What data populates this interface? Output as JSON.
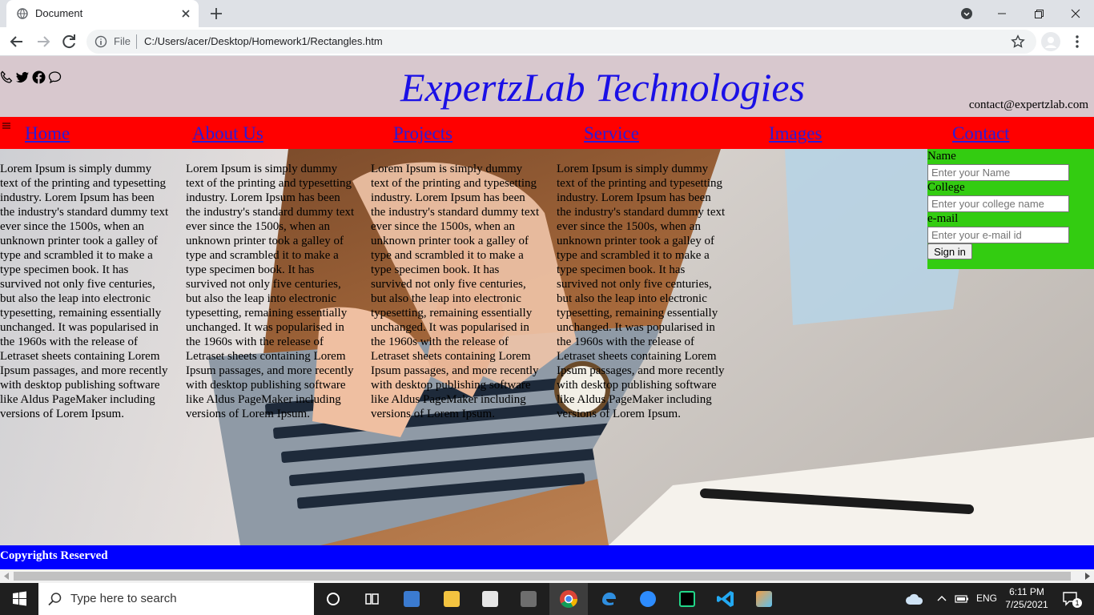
{
  "browser": {
    "tab_title": "Document",
    "omnibox_scheme": "File",
    "url": "C:/Users/acer/Desktop/Homework1/Rectangles.htm"
  },
  "page": {
    "header": {
      "title": "ExpertzLab Technologies",
      "email": "contact@expertzlab.com",
      "social_icons": [
        "phone-icon",
        "twitter-icon",
        "facebook-icon",
        "chat-icon"
      ]
    },
    "nav": {
      "items": [
        "Home",
        "About Us",
        "Projects",
        "Service",
        "Images",
        "Contact"
      ]
    },
    "columns": [
      "Lorem Ipsum is simply dummy text of the printing and typesetting industry. Lorem Ipsum has been the industry's standard dummy text ever since the 1500s, when an unknown printer took a galley of type and scrambled it to make a type specimen book. It has survived not only five centuries, but also the leap into electronic typesetting, remaining essentially unchanged. It was popularised in the 1960s with the release of Letraset sheets containing Lorem Ipsum passages, and more recently with desktop publishing software like Aldus PageMaker including versions of Lorem Ipsum.",
      "Lorem Ipsum is simply dummy text of the printing and typesetting industry. Lorem Ipsum has been the industry's standard dummy text ever since the 1500s, when an unknown printer took a galley of type and scrambled it to make a type specimen book. It has survived not only five centuries, but also the leap into electronic typesetting, remaining essentially unchanged. It was popularised in the 1960s with the release of Letraset sheets containing Lorem Ipsum passages, and more recently with desktop publishing software like Aldus PageMaker including versions of Lorem Ipsum.",
      "Lorem Ipsum is simply dummy text of the printing and typesetting industry. Lorem Ipsum has been the industry's standard dummy text ever since the 1500s, when an unknown printer took a galley of type and scrambled it to make a type specimen book. It has survived not only five centuries, but also the leap into electronic typesetting, remaining essentially unchanged. It was popularised in the 1960s with the release of Letraset sheets containing Lorem Ipsum passages, and more recently with desktop publishing software like Aldus PageMaker including versions of Lorem Ipsum.",
      "Lorem Ipsum is simply dummy text of the printing and typesetting industry. Lorem Ipsum has been the industry's standard dummy text ever since the 1500s, when an unknown printer took a galley of type and scrambled it to make a type specimen book. It has survived not only five centuries, but also the leap into electronic typesetting, remaining essentially unchanged. It was popularised in the 1960s with the release of Letraset sheets containing Lorem Ipsum passages, and more recently with desktop publishing software like Aldus PageMaker including versions of Lorem Ipsum."
    ],
    "form": {
      "name_label": "Name",
      "name_placeholder": "Enter your Name",
      "college_label": "College",
      "college_placeholder": "Enter your college name",
      "email_label": "e-mail",
      "email_placeholder": "Enter your e-mail id",
      "submit_label": "Sign in"
    },
    "footer": "Copyrights Reserved"
  },
  "taskbar": {
    "search_placeholder": "Type here to search",
    "language": "ENG",
    "time": "6:11 PM",
    "date": "7/25/2021",
    "notification_count": "1"
  },
  "colors": {
    "header_bg": "#d8c8ce",
    "title_color": "#1a10e6",
    "nav_bg": "#ff0000",
    "form_bg": "#33cc11",
    "footer_bg": "#0000ff"
  }
}
